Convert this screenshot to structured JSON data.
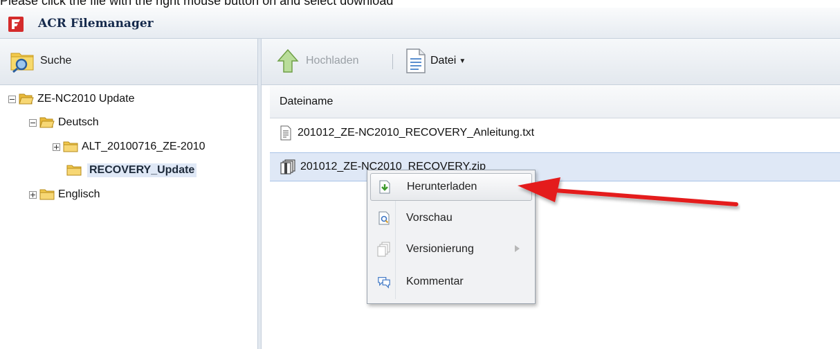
{
  "instruction": "Please click the file with the right mouse button on and select download",
  "window": {
    "title": "ACR Filemanager"
  },
  "left_toolbar": {
    "search_label": "Suche"
  },
  "tree": {
    "root": {
      "label": "ZE-NC2010 Update"
    },
    "deutsch": {
      "label": "Deutsch"
    },
    "alt": {
      "label": "ALT_20100716_ZE-2010"
    },
    "recovery": {
      "label": "RECOVERY_Update"
    },
    "englisch": {
      "label": "Englisch"
    }
  },
  "right_toolbar": {
    "upload_label": "Hochladen",
    "file_menu_label": "Datei"
  },
  "grid": {
    "column_header": "Dateiname",
    "files": [
      {
        "name": "201012_ZE-NC2010_RECOVERY_Anleitung.txt",
        "icon": "text-file-icon"
      },
      {
        "name": "201012_ZE-NC2010_RECOVERY.zip",
        "icon": "zip-file-icon"
      }
    ]
  },
  "context_menu": {
    "items": [
      {
        "label": "Herunterladen",
        "icon": "download-icon"
      },
      {
        "label": "Vorschau",
        "icon": "preview-icon"
      },
      {
        "label": "Versionierung",
        "icon": "versioning-icon"
      },
      {
        "label": "Kommentar",
        "icon": "comment-icon"
      }
    ]
  },
  "colors": {
    "selection": "#dfe8f6",
    "annotation_arrow": "#e41e1e",
    "folder": "#f2c94c"
  }
}
